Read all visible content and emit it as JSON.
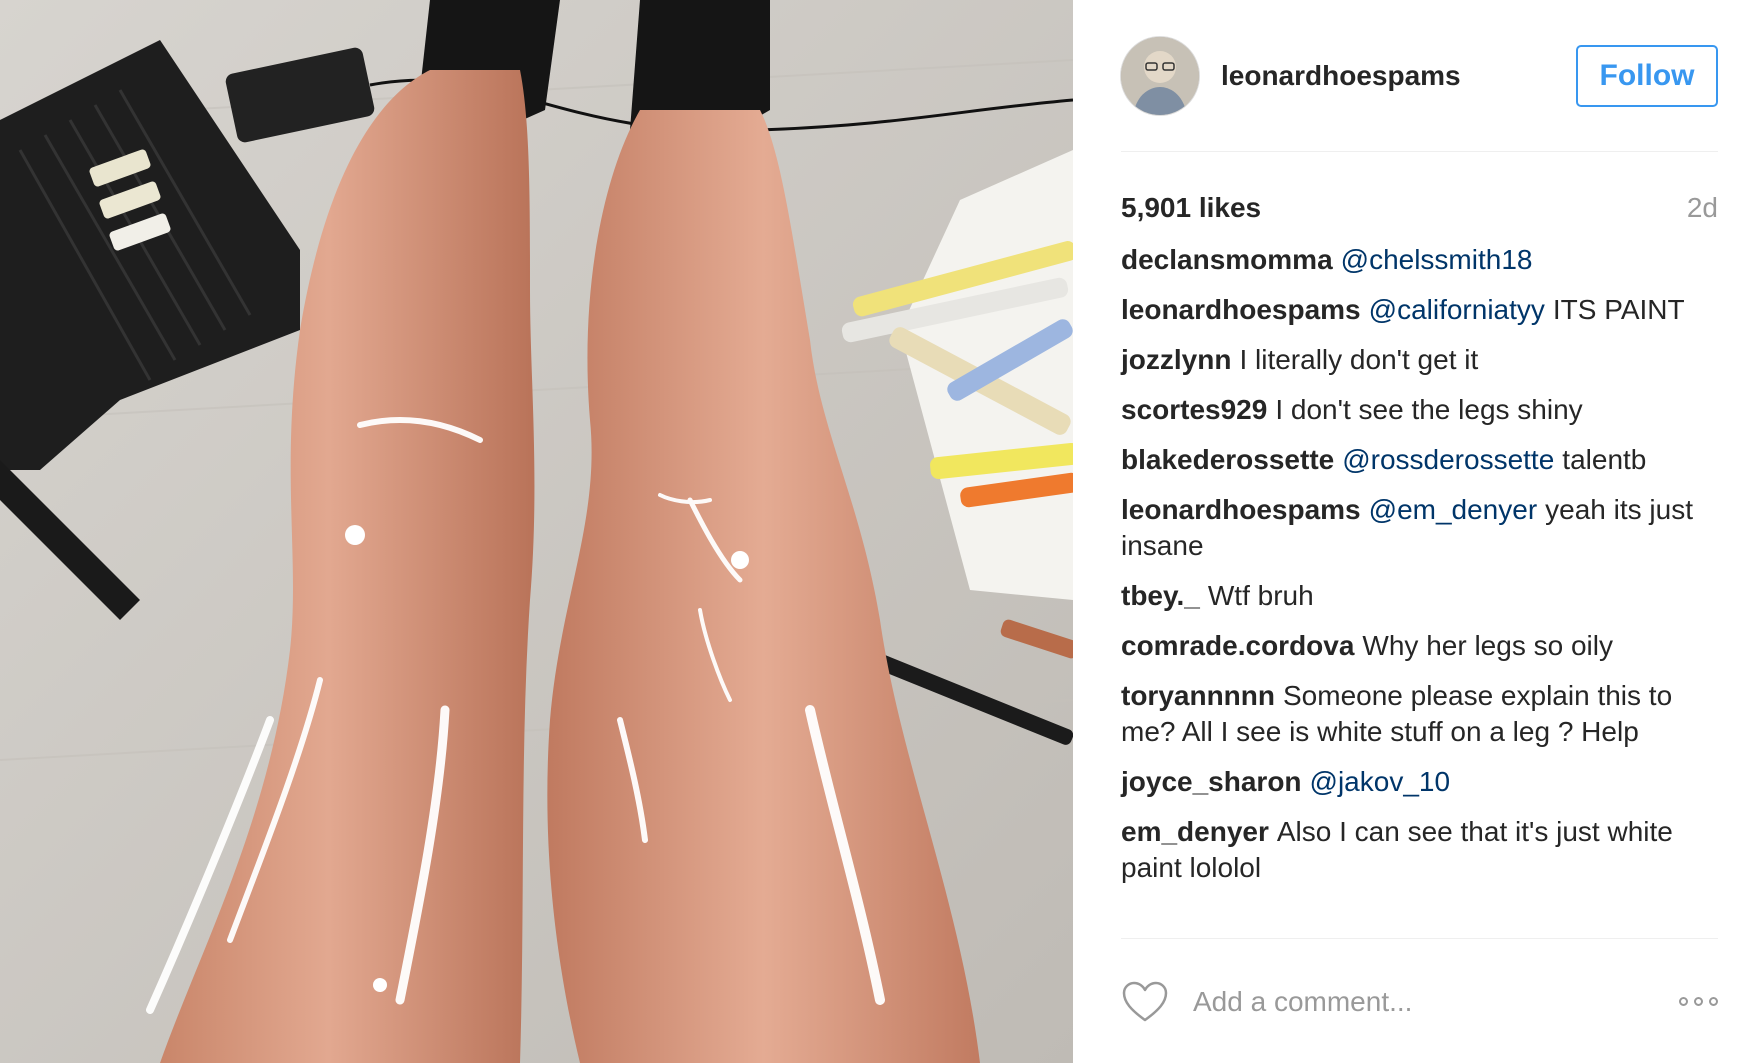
{
  "post": {
    "username": "leonardhoespams",
    "follow_label": "Follow",
    "likes": "5,901 likes",
    "age": "2d",
    "comment_placeholder": "Add a comment...",
    "accent_color": "#3897f0",
    "mention_color": "#003569"
  },
  "comments": [
    {
      "author": "declansmomma",
      "mention": "@chelssmith18",
      "text": ""
    },
    {
      "author": "leonardhoespams",
      "mention": "@californiatyy",
      "text": "ITS PAINT"
    },
    {
      "author": "jozzlynn",
      "mention": "",
      "text": "I literally don't get it"
    },
    {
      "author": "scortes929",
      "mention": "",
      "text": "I don't see the legs shiny"
    },
    {
      "author": "blakederossette",
      "mention": "@rossderossette",
      "text": "talentb"
    },
    {
      "author": "leonardhoespams",
      "mention": "@em_denyer",
      "text": "yeah its just insane"
    },
    {
      "author": "tbey._",
      "mention": "",
      "text": "Wtf bruh"
    },
    {
      "author": "comrade.cordova",
      "mention": "",
      "text": "Why her legs so oily"
    },
    {
      "author": "toryannnnn",
      "mention": "",
      "text": "Someone please explain this to me? All I see is white stuff on a leg ? Help"
    },
    {
      "author": "joyce_sharon",
      "mention": "@jakov_10",
      "text": ""
    },
    {
      "author": "em_denyer",
      "mention": "",
      "text": "Also I can see that it's just white paint lololol"
    }
  ],
  "icons": {
    "like": "heart-icon",
    "options": "more-options-icon"
  }
}
